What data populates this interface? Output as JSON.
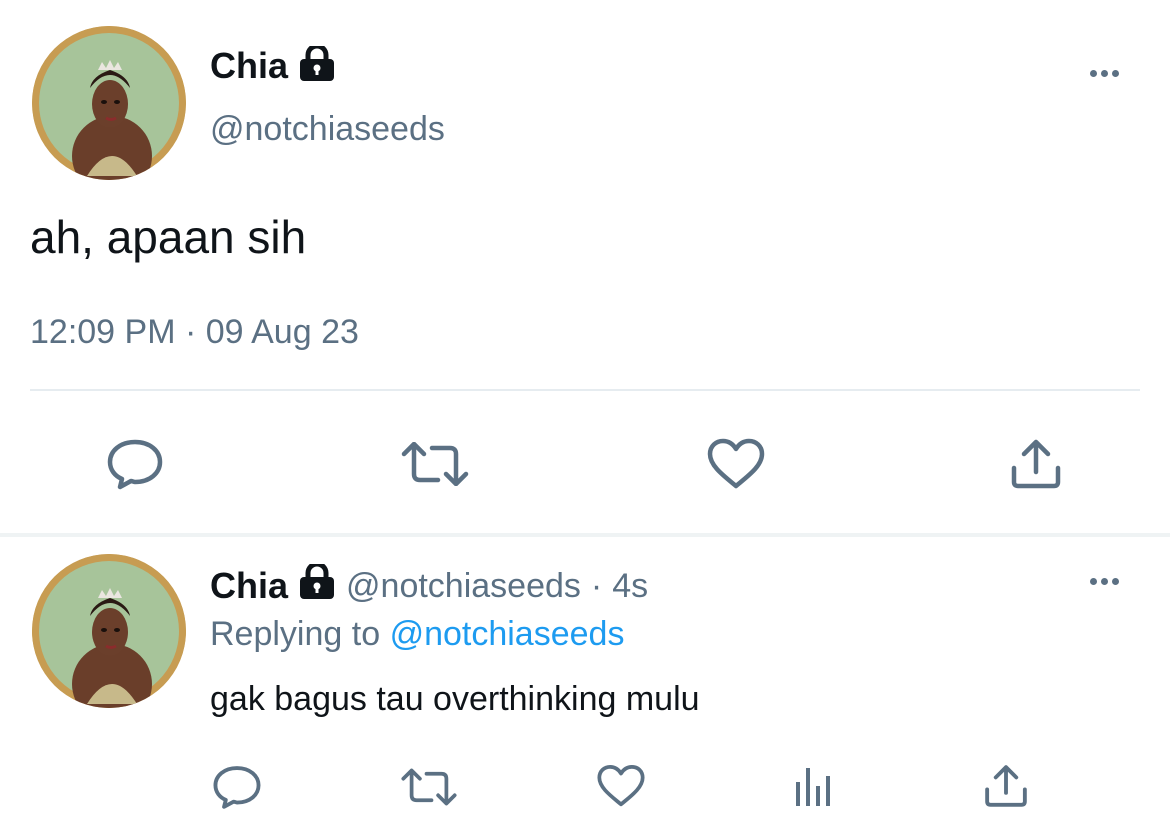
{
  "main_tweet": {
    "display_name": "Chia",
    "handle": "@notchiaseeds",
    "text": "ah, apaan sih",
    "timestamp": "12:09 PM · 09 Aug 23",
    "actions": [
      "reply-icon",
      "retweet-icon",
      "like-icon",
      "share-icon"
    ]
  },
  "reply_tweet": {
    "display_name": "Chia",
    "handle": "@notchiaseeds",
    "separator": "·",
    "age": "4s",
    "replying_prefix": "Replying to",
    "replying_to": "@notchiaseeds",
    "text": "gak bagus tau overthinking mulu",
    "actions": [
      "reply-icon",
      "retweet-icon",
      "like-icon",
      "analytics-icon",
      "share-icon"
    ]
  },
  "colors": {
    "text": "#0f1419",
    "muted": "#5b7083",
    "link": "#1d9bf0",
    "divider": "#e6ecf0"
  }
}
